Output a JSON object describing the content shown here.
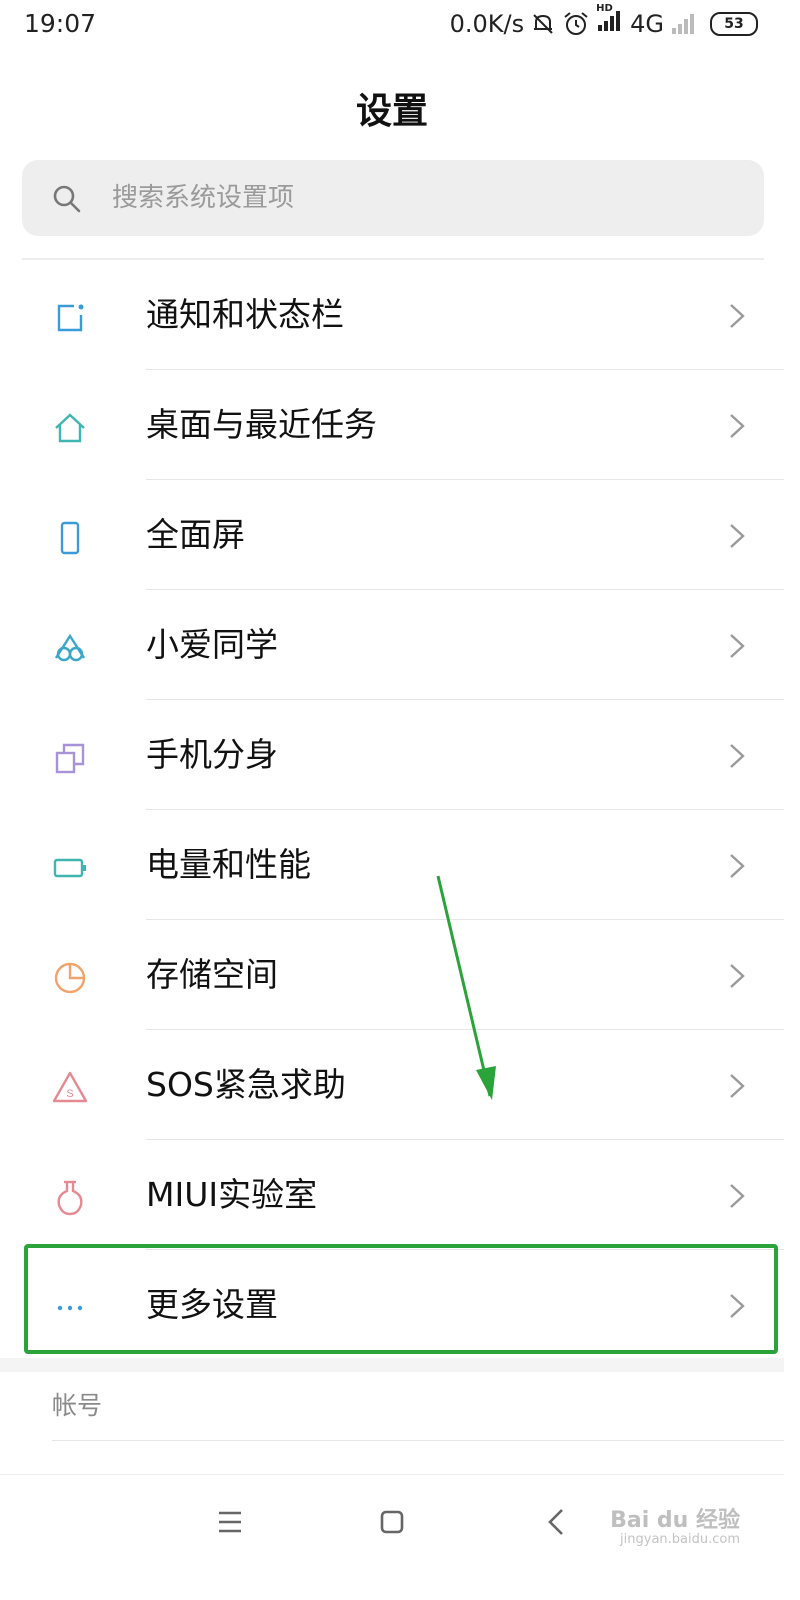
{
  "status_bar": {
    "time": "19:07",
    "net_speed": "0.0K/s",
    "network": "4G",
    "network_tag": "HD",
    "battery": "53",
    "icons": [
      "mute-bell-icon",
      "alarm-clock-icon",
      "signal-icon",
      "signal-weak-icon",
      "battery-icon"
    ]
  },
  "header": {
    "title": "设置"
  },
  "search": {
    "placeholder": "搜索系统设置项"
  },
  "menu": {
    "items": [
      {
        "label": "通知和状态栏",
        "icon": "notification-icon",
        "color": "#3a9bd9"
      },
      {
        "label": "桌面与最近任务",
        "icon": "home-icon",
        "color": "#3fb6b0"
      },
      {
        "label": "全面屏",
        "icon": "phone-screen-icon",
        "color": "#3a9bd9"
      },
      {
        "label": "小爱同学",
        "icon": "xiaoai-icon",
        "color": "#3aa7c9"
      },
      {
        "label": "手机分身",
        "icon": "second-space-icon",
        "color": "#a892d8"
      },
      {
        "label": "电量和性能",
        "icon": "battery-performance-icon",
        "color": "#3fb6b0"
      },
      {
        "label": "存储空间",
        "icon": "storage-pie-icon",
        "color": "#f0a36a"
      },
      {
        "label": "SOS紧急求助",
        "icon": "sos-icon",
        "color": "#e58a92"
      },
      {
        "label": "MIUI实验室",
        "icon": "lab-flask-icon",
        "color": "#e58a92"
      },
      {
        "label": "更多设置",
        "icon": "more-dots-icon",
        "color": "#3a9bd9"
      }
    ]
  },
  "annotation": {
    "highlight_color": "#2aa43a",
    "highlighted_item": "更多设置"
  },
  "section": {
    "account_header": "帐号"
  },
  "navbar": {
    "buttons": [
      "menu-icon",
      "home-square-icon",
      "back-icon"
    ]
  },
  "watermark": {
    "text": "Bai du 经验",
    "sub": "jingyan.baidu.com"
  }
}
